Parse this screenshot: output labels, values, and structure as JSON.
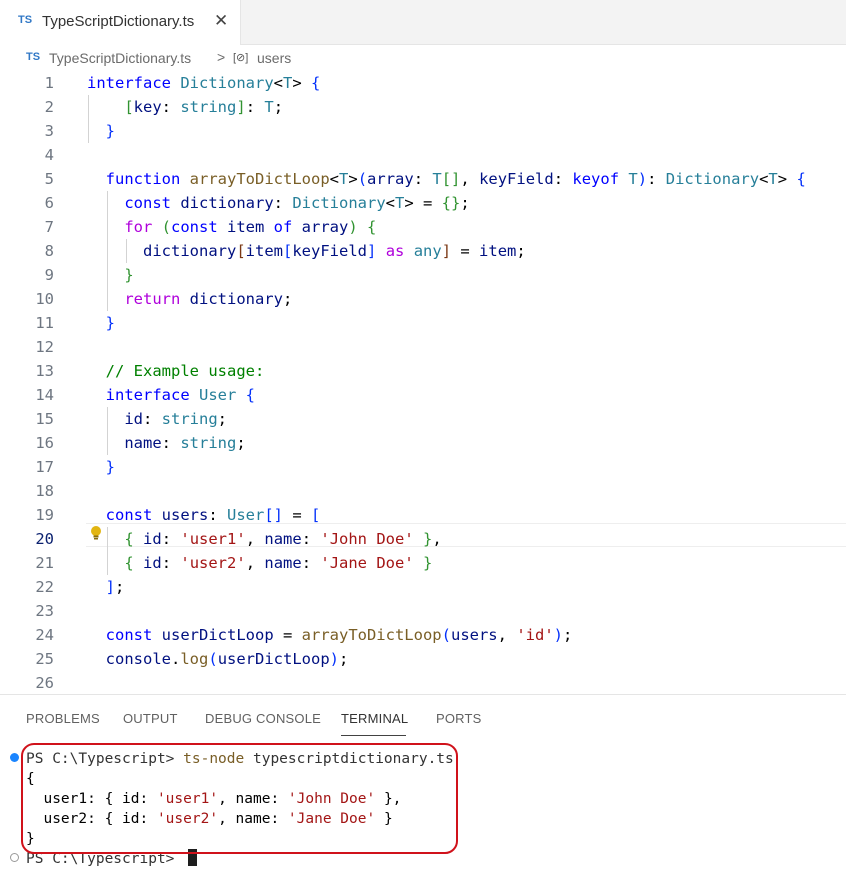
{
  "tab": {
    "lang_badge": "TS",
    "filename": "TypeScriptDictionary.ts",
    "close_glyph": "✕"
  },
  "breadcrumb": {
    "lang_badge": "TS",
    "file": "TypeScriptDictionary.ts",
    "separator": ">",
    "symbol_glyph": "[⊘]",
    "symbol": "users"
  },
  "editor": {
    "active_line": 20,
    "lines": [
      {
        "n": "1",
        "t": [
          [
            "kw",
            "interface "
          ],
          [
            "ty",
            "Dictionary"
          ],
          [
            "pu",
            "<"
          ],
          [
            "ty",
            "T"
          ],
          [
            "pu",
            "> "
          ],
          [
            "b1",
            "{"
          ]
        ]
      },
      {
        "n": "2",
        "t": [
          [
            "pu",
            "    "
          ],
          [
            "b2",
            "["
          ],
          [
            "va",
            "key"
          ],
          [
            "pu",
            ": "
          ],
          [
            "ty",
            "string"
          ],
          [
            "b2",
            "]"
          ],
          [
            "pu",
            ": "
          ],
          [
            "ty",
            "T"
          ],
          [
            "pu",
            ";"
          ]
        ]
      },
      {
        "n": "3",
        "t": [
          [
            "pu",
            "  "
          ],
          [
            "b1",
            "}"
          ]
        ]
      },
      {
        "n": "4",
        "t": []
      },
      {
        "n": "5",
        "t": [
          [
            "pu",
            "  "
          ],
          [
            "kw",
            "function "
          ],
          [
            "fn",
            "arrayToDictLoop"
          ],
          [
            "pu",
            "<"
          ],
          [
            "ty",
            "T"
          ],
          [
            "pu",
            ">"
          ],
          [
            "b1",
            "("
          ],
          [
            "va",
            "array"
          ],
          [
            "pu",
            ": "
          ],
          [
            "ty",
            "T"
          ],
          [
            "b2",
            "[]"
          ],
          [
            "pu",
            ", "
          ],
          [
            "va",
            "keyField"
          ],
          [
            "pu",
            ": "
          ],
          [
            "kw",
            "keyof "
          ],
          [
            "ty",
            "T"
          ],
          [
            "b1",
            ")"
          ],
          [
            "pu",
            ": "
          ],
          [
            "ty",
            "Dictionary"
          ],
          [
            "pu",
            "<"
          ],
          [
            "ty",
            "T"
          ],
          [
            "pu",
            "> "
          ],
          [
            "b1",
            "{"
          ]
        ]
      },
      {
        "n": "6",
        "t": [
          [
            "pu",
            "    "
          ],
          [
            "kw",
            "const "
          ],
          [
            "va",
            "dictionary"
          ],
          [
            "pu",
            ": "
          ],
          [
            "ty",
            "Dictionary"
          ],
          [
            "pu",
            "<"
          ],
          [
            "ty",
            "T"
          ],
          [
            "pu",
            "> = "
          ],
          [
            "b2",
            "{}"
          ],
          [
            "pu",
            ";"
          ]
        ]
      },
      {
        "n": "7",
        "t": [
          [
            "pu",
            "    "
          ],
          [
            "ctl",
            "for "
          ],
          [
            "b2",
            "("
          ],
          [
            "kw",
            "const "
          ],
          [
            "va",
            "item "
          ],
          [
            "kw",
            "of "
          ],
          [
            "va",
            "array"
          ],
          [
            "b2",
            ")"
          ],
          [
            "pu",
            " "
          ],
          [
            "b2",
            "{"
          ]
        ]
      },
      {
        "n": "8",
        "t": [
          [
            "pu",
            "      "
          ],
          [
            "va",
            "dictionary"
          ],
          [
            "b3",
            "["
          ],
          [
            "va",
            "item"
          ],
          [
            "b1",
            "["
          ],
          [
            "va",
            "keyField"
          ],
          [
            "b1",
            "]"
          ],
          [
            "pu",
            " "
          ],
          [
            "ctl",
            "as "
          ],
          [
            "ty",
            "any"
          ],
          [
            "b3",
            "]"
          ],
          [
            "pu",
            " = "
          ],
          [
            "va",
            "item"
          ],
          [
            "pu",
            ";"
          ]
        ]
      },
      {
        "n": "9",
        "t": [
          [
            "pu",
            "    "
          ],
          [
            "b2",
            "}"
          ]
        ]
      },
      {
        "n": "10",
        "t": [
          [
            "pu",
            "    "
          ],
          [
            "ctl",
            "return "
          ],
          [
            "va",
            "dictionary"
          ],
          [
            "pu",
            ";"
          ]
        ]
      },
      {
        "n": "11",
        "t": [
          [
            "pu",
            "  "
          ],
          [
            "b1",
            "}"
          ]
        ]
      },
      {
        "n": "12",
        "t": []
      },
      {
        "n": "13",
        "t": [
          [
            "pu",
            "  "
          ],
          [
            "cm",
            "// Example usage:"
          ]
        ]
      },
      {
        "n": "14",
        "t": [
          [
            "pu",
            "  "
          ],
          [
            "kw",
            "interface "
          ],
          [
            "ty",
            "User "
          ],
          [
            "b1",
            "{"
          ]
        ]
      },
      {
        "n": "15",
        "t": [
          [
            "pu",
            "    "
          ],
          [
            "va",
            "id"
          ],
          [
            "pu",
            ": "
          ],
          [
            "ty",
            "string"
          ],
          [
            "pu",
            ";"
          ]
        ]
      },
      {
        "n": "16",
        "t": [
          [
            "pu",
            "    "
          ],
          [
            "va",
            "name"
          ],
          [
            "pu",
            ": "
          ],
          [
            "ty",
            "string"
          ],
          [
            "pu",
            ";"
          ]
        ]
      },
      {
        "n": "17",
        "t": [
          [
            "pu",
            "  "
          ],
          [
            "b1",
            "}"
          ]
        ]
      },
      {
        "n": "18",
        "t": []
      },
      {
        "n": "19",
        "t": [
          [
            "pu",
            "  "
          ],
          [
            "kw",
            "const "
          ],
          [
            "va",
            "users"
          ],
          [
            "pu",
            ": "
          ],
          [
            "ty",
            "User"
          ],
          [
            "b1",
            "[]"
          ],
          [
            "pu",
            " = "
          ],
          [
            "b1",
            "["
          ]
        ]
      },
      {
        "n": "20",
        "t": [
          [
            "pu",
            "    "
          ],
          [
            "b2",
            "{"
          ],
          [
            "pu",
            " "
          ],
          [
            "va",
            "id"
          ],
          [
            "pu",
            ": "
          ],
          [
            "st",
            "'user1'"
          ],
          [
            "pu",
            ", "
          ],
          [
            "va",
            "name"
          ],
          [
            "pu",
            ": "
          ],
          [
            "st",
            "'John Doe'"
          ],
          [
            "pu",
            " "
          ],
          [
            "b2",
            "}"
          ],
          [
            "pu",
            ","
          ]
        ]
      },
      {
        "n": "21",
        "t": [
          [
            "pu",
            "    "
          ],
          [
            "b2",
            "{"
          ],
          [
            "pu",
            " "
          ],
          [
            "va",
            "id"
          ],
          [
            "pu",
            ": "
          ],
          [
            "st",
            "'user2'"
          ],
          [
            "pu",
            ", "
          ],
          [
            "va",
            "name"
          ],
          [
            "pu",
            ": "
          ],
          [
            "st",
            "'Jane Doe'"
          ],
          [
            "pu",
            " "
          ],
          [
            "b2",
            "}"
          ]
        ]
      },
      {
        "n": "22",
        "t": [
          [
            "pu",
            "  "
          ],
          [
            "b1",
            "]"
          ],
          [
            "pu",
            ";"
          ]
        ]
      },
      {
        "n": "23",
        "t": []
      },
      {
        "n": "24",
        "t": [
          [
            "pu",
            "  "
          ],
          [
            "kw",
            "const "
          ],
          [
            "va",
            "userDictLoop"
          ],
          [
            "pu",
            " = "
          ],
          [
            "fn",
            "arrayToDictLoop"
          ],
          [
            "b1",
            "("
          ],
          [
            "va",
            "users"
          ],
          [
            "pu",
            ", "
          ],
          [
            "st",
            "'id'"
          ],
          [
            "b1",
            ")"
          ],
          [
            "pu",
            ";"
          ]
        ]
      },
      {
        "n": "25",
        "t": [
          [
            "pu",
            "  "
          ],
          [
            "va",
            "console"
          ],
          [
            "pu",
            "."
          ],
          [
            "fn",
            "log"
          ],
          [
            "b1",
            "("
          ],
          [
            "va",
            "userDictLoop"
          ],
          [
            "b1",
            ")"
          ],
          [
            "pu",
            ";"
          ]
        ]
      },
      {
        "n": "26",
        "t": []
      }
    ]
  },
  "panel": {
    "tabs": [
      "PROBLEMS",
      "OUTPUT",
      "DEBUG CONSOLE",
      "TERMINAL",
      "PORTS"
    ],
    "active_tab": "TERMINAL",
    "terminal": {
      "prompt": "PS C:\\Typescript> ",
      "command": "ts-node",
      "argument": " typescriptdictionary.ts",
      "output": [
        [
          [
            "pu",
            "{"
          ]
        ],
        [
          [
            "pu",
            "  user1: { id: "
          ],
          [
            "ts2",
            "'user1'"
          ],
          [
            "pu",
            ", name: "
          ],
          [
            "ts2",
            "'John Doe'"
          ],
          [
            "pu",
            " },"
          ]
        ],
        [
          [
            "pu",
            "  user2: { id: "
          ],
          [
            "ts2",
            "'user2'"
          ],
          [
            "pu",
            ", name: "
          ],
          [
            "ts2",
            "'Jane Doe'"
          ],
          [
            "pu",
            " }"
          ]
        ],
        [
          [
            "pu",
            "}"
          ]
        ]
      ],
      "last_prompt": "PS C:\\Typescript> "
    }
  },
  "colors": {
    "ts_badge": "#3178c6",
    "highlight_box": "#d0121b",
    "terminal_dot": "#1a85ff",
    "keyword": "#0000ff",
    "string": "#a31515"
  }
}
